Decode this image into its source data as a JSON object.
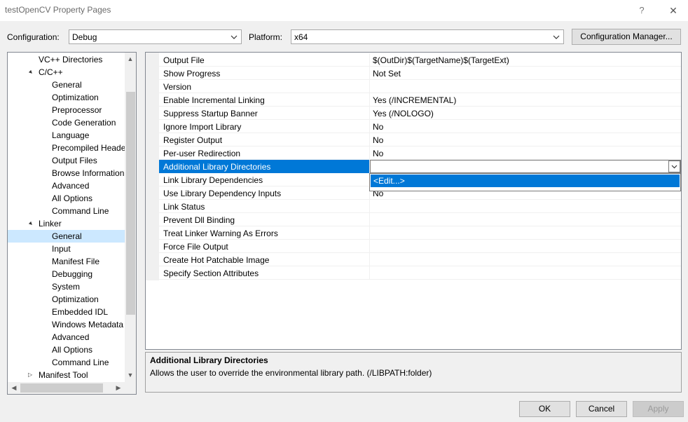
{
  "window": {
    "title": "testOpenCV Property Pages",
    "help_glyph": "?",
    "close_glyph": "✕"
  },
  "config_bar": {
    "configuration_label": "Configuration:",
    "configuration_value": "Debug",
    "platform_label": "Platform:",
    "platform_value": "x64",
    "config_manager_button": "Configuration Manager..."
  },
  "tree": {
    "items": [
      {
        "label": "VC++ Directories",
        "level": 1,
        "expander": ""
      },
      {
        "label": "C/C++",
        "level": 1,
        "expander": "▲"
      },
      {
        "label": "General",
        "level": 2,
        "expander": ""
      },
      {
        "label": "Optimization",
        "level": 2,
        "expander": ""
      },
      {
        "label": "Preprocessor",
        "level": 2,
        "expander": ""
      },
      {
        "label": "Code Generation",
        "level": 2,
        "expander": ""
      },
      {
        "label": "Language",
        "level": 2,
        "expander": ""
      },
      {
        "label": "Precompiled Heade",
        "level": 2,
        "expander": ""
      },
      {
        "label": "Output Files",
        "level": 2,
        "expander": ""
      },
      {
        "label": "Browse Information",
        "level": 2,
        "expander": ""
      },
      {
        "label": "Advanced",
        "level": 2,
        "expander": ""
      },
      {
        "label": "All Options",
        "level": 2,
        "expander": ""
      },
      {
        "label": "Command Line",
        "level": 2,
        "expander": ""
      },
      {
        "label": "Linker",
        "level": 1,
        "expander": "▲"
      },
      {
        "label": "General",
        "level": 2,
        "expander": "",
        "selected": true
      },
      {
        "label": "Input",
        "level": 2,
        "expander": ""
      },
      {
        "label": "Manifest File",
        "level": 2,
        "expander": ""
      },
      {
        "label": "Debugging",
        "level": 2,
        "expander": ""
      },
      {
        "label": "System",
        "level": 2,
        "expander": ""
      },
      {
        "label": "Optimization",
        "level": 2,
        "expander": ""
      },
      {
        "label": "Embedded IDL",
        "level": 2,
        "expander": ""
      },
      {
        "label": "Windows Metadata",
        "level": 2,
        "expander": ""
      },
      {
        "label": "Advanced",
        "level": 2,
        "expander": ""
      },
      {
        "label": "All Options",
        "level": 2,
        "expander": ""
      },
      {
        "label": "Command Line",
        "level": 2,
        "expander": ""
      },
      {
        "label": "Manifest Tool",
        "level": 1,
        "expander": "▷"
      }
    ]
  },
  "grid": {
    "rows": [
      {
        "name": "Output File",
        "value": "$(OutDir)$(TargetName)$(TargetExt)"
      },
      {
        "name": "Show Progress",
        "value": "Not Set"
      },
      {
        "name": "Version",
        "value": ""
      },
      {
        "name": "Enable Incremental Linking",
        "value": "Yes (/INCREMENTAL)"
      },
      {
        "name": "Suppress Startup Banner",
        "value": "Yes (/NOLOGO)"
      },
      {
        "name": "Ignore Import Library",
        "value": "No"
      },
      {
        "name": "Register Output",
        "value": "No"
      },
      {
        "name": "Per-user Redirection",
        "value": "No"
      },
      {
        "name": "Additional Library Directories",
        "value": "",
        "selected": true
      },
      {
        "name": "Link Library Dependencies",
        "value": ""
      },
      {
        "name": "Use Library Dependency Inputs",
        "value": "No"
      },
      {
        "name": "Link Status",
        "value": ""
      },
      {
        "name": "Prevent Dll Binding",
        "value": ""
      },
      {
        "name": "Treat Linker Warning As Errors",
        "value": ""
      },
      {
        "name": "Force File Output",
        "value": ""
      },
      {
        "name": "Create Hot Patchable Image",
        "value": ""
      },
      {
        "name": "Specify Section Attributes",
        "value": ""
      }
    ],
    "dropdown_option": "<Edit...>"
  },
  "description": {
    "title": "Additional Library Directories",
    "text": "Allows the user to override the environmental library path. (/LIBPATH:folder)"
  },
  "buttons": {
    "ok": "OK",
    "cancel": "Cancel",
    "apply": "Apply"
  },
  "colors": {
    "selection_blue": "#0078d7",
    "tree_selection": "#cce8ff",
    "dialog_bg": "#f0f0f0"
  }
}
